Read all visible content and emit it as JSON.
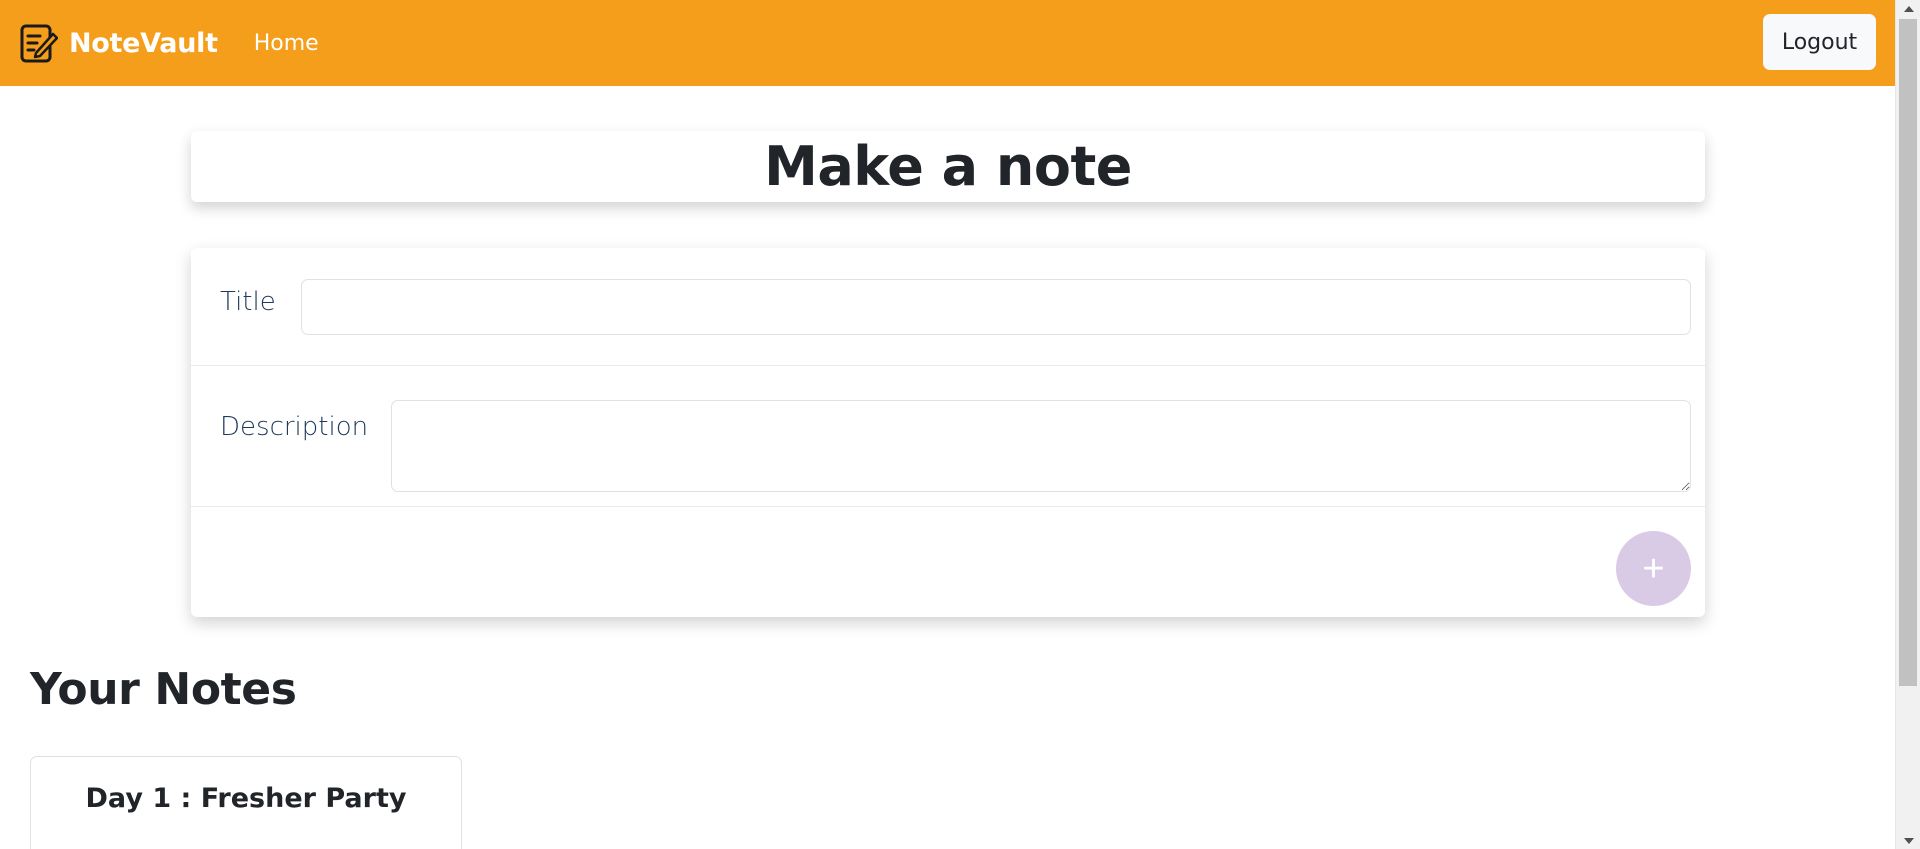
{
  "navbar": {
    "brand": "NoteVault",
    "brand_icon": "notebook-pen-icon",
    "home_label": "Home",
    "logout_label": "Logout",
    "background": "#f59e1b"
  },
  "header": {
    "title": "Make a note"
  },
  "form": {
    "title_label": "Title",
    "title_value": "",
    "description_label": "Description",
    "description_value": "",
    "add_icon": "plus-icon",
    "add_button_color": "#d9cbe6"
  },
  "notes_section": {
    "heading": "Your Notes",
    "notes": [
      {
        "title": "Day 1 : Fresher Party"
      }
    ]
  }
}
